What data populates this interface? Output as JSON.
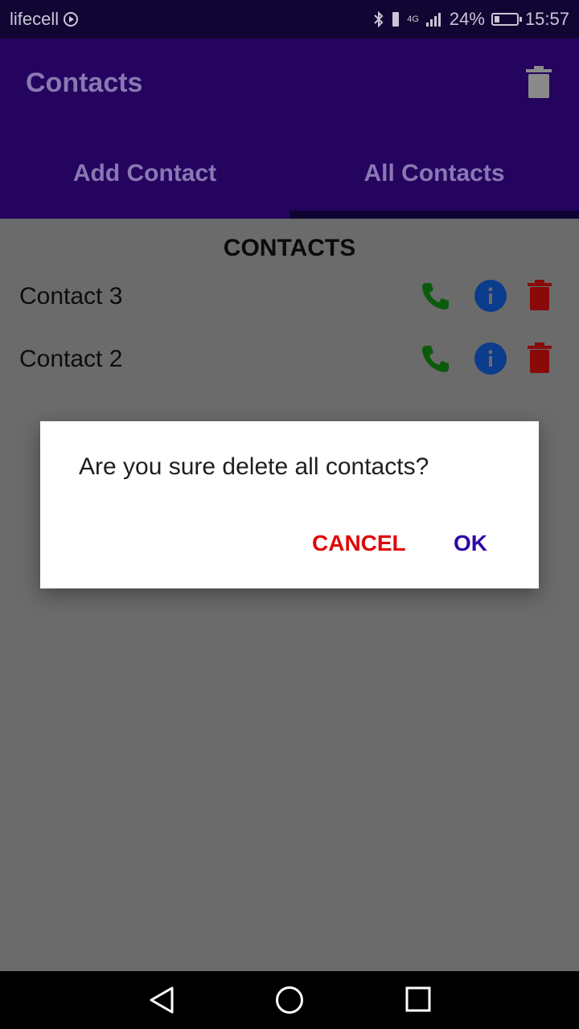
{
  "status": {
    "carrier": "lifecell",
    "network": "4G",
    "battery_text": "24%",
    "battery_level": 0.24,
    "time": "15:57"
  },
  "appbar": {
    "title": "Contacts",
    "tabs": [
      "Add Contact",
      "All Contacts"
    ],
    "active_tab": 1
  },
  "content": {
    "section_title": "CONTACTS",
    "contacts": [
      {
        "name": "Contact 3"
      },
      {
        "name": "Contact 2"
      }
    ]
  },
  "dialog": {
    "message": "Are you sure delete all contacts?",
    "cancel_label": "CANCEL",
    "ok_label": "OK"
  },
  "colors": {
    "call": "#0c5a0c",
    "info": "#0c3c8c",
    "delete": "#8a0a0a",
    "cancel": "#e00808",
    "ok": "#2e07a8"
  },
  "icons": {
    "call": "phone-icon",
    "info": "info-icon",
    "delete": "trash-icon"
  }
}
